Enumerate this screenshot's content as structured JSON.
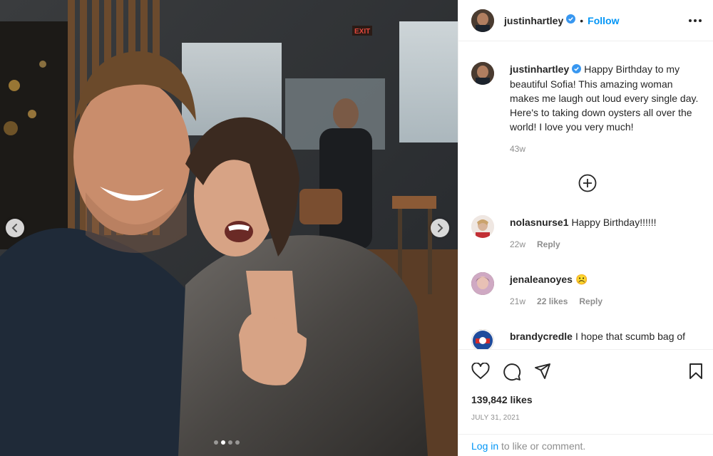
{
  "post": {
    "username": "justinhartley",
    "follow_label": "Follow",
    "separator": "•",
    "caption": "Happy Birthday to my beautiful Sofia! This amazing woman makes me laugh out loud every single day. Here's to taking down oysters all over the world! I love you very much!",
    "caption_age": "43w",
    "likes": "139,842 likes",
    "date": "JULY 31, 2021",
    "carousel": {
      "dot_count": 4,
      "active_index": 1
    }
  },
  "comments": [
    {
      "username": "nolasnurse1",
      "text": "Happy Birthday!!!!!!",
      "age": "22w",
      "likes": "",
      "reply": "Reply"
    },
    {
      "username": "jenaleanoyes",
      "text": "☹️",
      "age": "21w",
      "likes": "22 likes",
      "reply": "Reply"
    },
    {
      "username": "brandycredle",
      "text": "I hope that scumb bag of",
      "age": "",
      "likes": "",
      "reply": ""
    }
  ],
  "footer": {
    "login_link": "Log in",
    "login_suffix": " to like or comment."
  },
  "icons": {
    "verified": "verified-badge-icon",
    "more": "more-options-icon",
    "add_comment": "plus-circle-icon",
    "like": "heart-icon",
    "comment": "comment-icon",
    "share": "share-icon",
    "save": "bookmark-icon",
    "prev": "chevron-left-icon",
    "next": "chevron-right-icon"
  },
  "colors": {
    "accent": "#0095f6",
    "text": "#262626",
    "muted": "#8e8e8e",
    "divider": "#efefef"
  }
}
